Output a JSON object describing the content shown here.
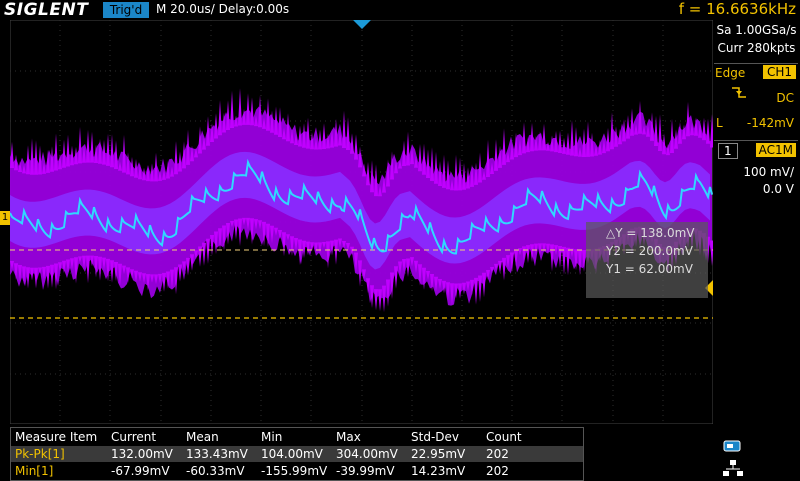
{
  "topbar": {
    "logo": "SIGLENT",
    "trig_status": "Trig'd",
    "timebase": "M 20.0us/  Delay:0.00s",
    "frequency": "f = 16.6636kHz"
  },
  "acquisition": {
    "sample_rate": "Sa 1.00GSa/s",
    "memory": "Curr 280kpts"
  },
  "trigger": {
    "mode": "Edge",
    "source": "CH1",
    "coupling": "DC",
    "level_label": "L",
    "level": "-142mV"
  },
  "channel": {
    "number": "1",
    "coupling": "AC1M",
    "scale": "100 mV/",
    "offset": "0.0 V"
  },
  "cursors": {
    "delta_y": "△Y = 138.0mV",
    "y2": "Y2 = 200.0mV",
    "y1": "Y1 = 62.00mV"
  },
  "ch_marker": "1",
  "measure": {
    "headers": [
      "Measure Item",
      "Current",
      "Mean",
      "Min",
      "Max",
      "Std-Dev",
      "Count"
    ],
    "rows": [
      [
        "Pk-Pk[1]",
        "132.00mV",
        "133.43mV",
        "104.00mV",
        "304.00mV",
        "22.95mV",
        "202"
      ],
      [
        "Min[1]",
        "-67.99mV",
        "-60.33mV",
        "-155.99mV",
        "-39.99mV",
        "14.23mV",
        "202"
      ]
    ]
  },
  "colors": {
    "trace_persist": "#c000ff",
    "trace_main": "#30d8ff",
    "accent": "#f2c200",
    "trig_badge": "#1b86c8"
  }
}
